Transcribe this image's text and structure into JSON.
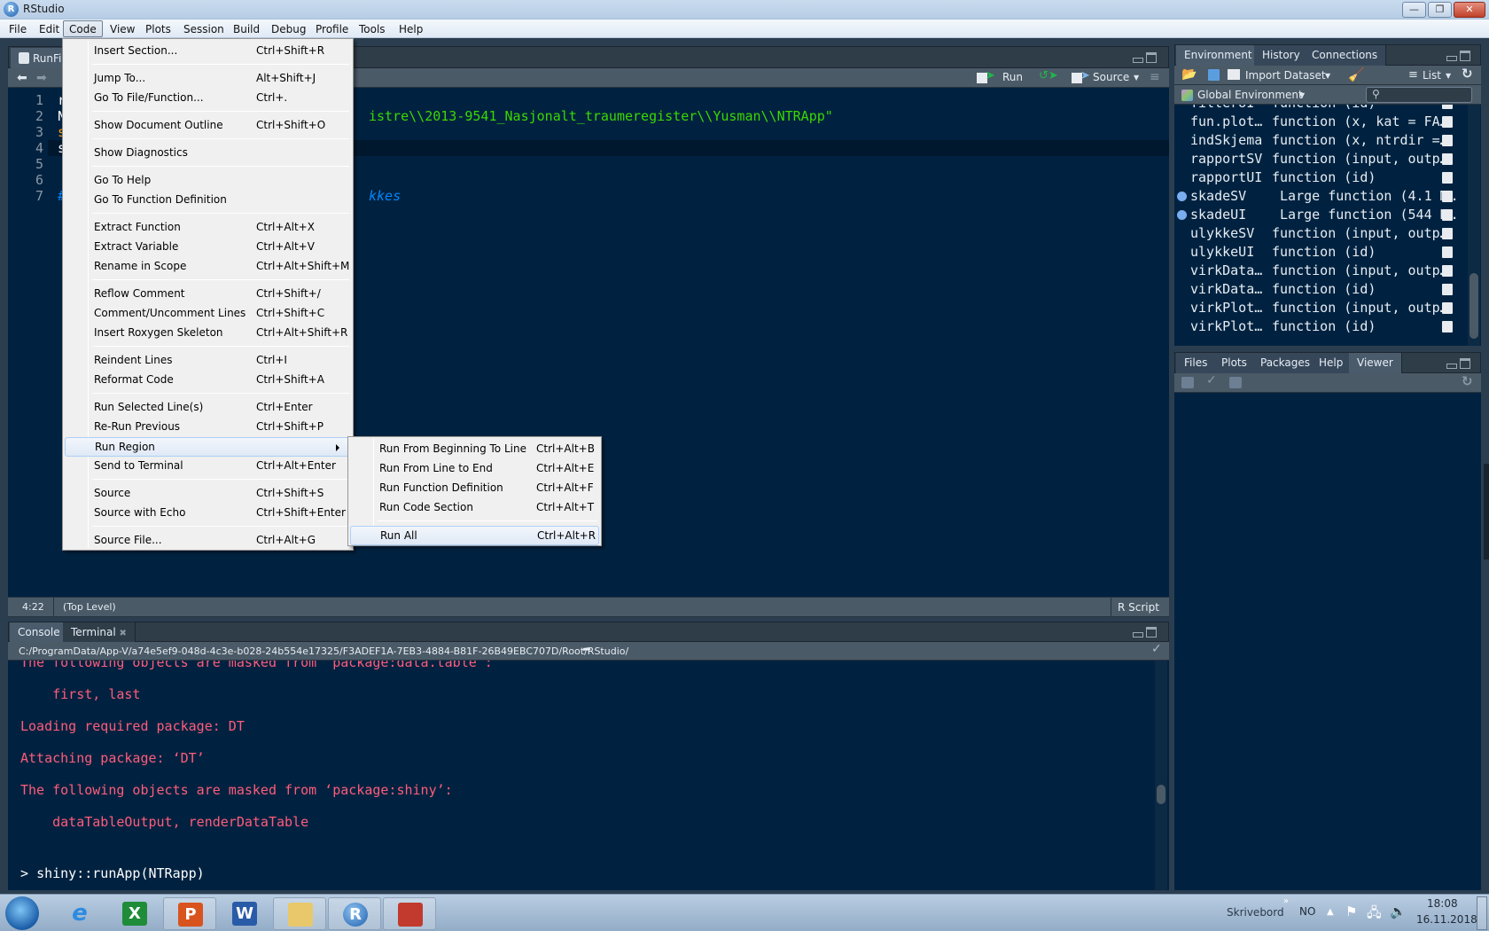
{
  "window": {
    "title": "RStudio",
    "app_icon": "R",
    "controls": [
      "minimize",
      "restore",
      "close"
    ]
  },
  "menubar": [
    "File",
    "Edit",
    "Code",
    "View",
    "Plots",
    "Session",
    "Build",
    "Debug",
    "Profile",
    "Tools",
    "Help"
  ],
  "menubar_open": "Code",
  "editor": {
    "tab_label": "RunFil",
    "toolbar": {
      "run": "Run",
      "source": "Source"
    },
    "lines": [
      {
        "no": "1",
        "visible": "rm"
      },
      {
        "no": "2",
        "visible": "NT",
        "string_tail": "istre\\\\2013-9541_Nasjonalt_traumeregister\\\\Yusman\\\\NTRApp\""
      },
      {
        "no": "3",
        "visible": "sc"
      },
      {
        "no": "4",
        "visible": "sh"
      },
      {
        "no": "5",
        "visible": ""
      },
      {
        "no": "6",
        "visible": ""
      },
      {
        "no": "7",
        "visible": "##",
        "comment_tail": "kkes"
      }
    ],
    "status": {
      "position": "4:22",
      "scope": "(Top Level)",
      "file_type": "R Script"
    }
  },
  "code_menu": {
    "groups": [
      [
        {
          "label": "Insert Section...",
          "key": "Ctrl+Shift+R"
        }
      ],
      [
        {
          "label": "Jump To...",
          "key": "Alt+Shift+J"
        },
        {
          "label": "Go To File/Function...",
          "key": "Ctrl+."
        }
      ],
      [
        {
          "label": "Show Document Outline",
          "key": "Ctrl+Shift+O"
        }
      ],
      [
        {
          "label": "Show Diagnostics",
          "key": ""
        }
      ],
      [
        {
          "label": "Go To Help",
          "key": ""
        },
        {
          "label": "Go To Function Definition",
          "key": ""
        }
      ],
      [
        {
          "label": "Extract Function",
          "key": "Ctrl+Alt+X"
        },
        {
          "label": "Extract Variable",
          "key": "Ctrl+Alt+V"
        },
        {
          "label": "Rename in Scope",
          "key": "Ctrl+Alt+Shift+M"
        }
      ],
      [
        {
          "label": "Reflow Comment",
          "key": "Ctrl+Shift+/"
        },
        {
          "label": "Comment/Uncomment Lines",
          "key": "Ctrl+Shift+C"
        },
        {
          "label": "Insert Roxygen Skeleton",
          "key": "Ctrl+Alt+Shift+R"
        }
      ],
      [
        {
          "label": "Reindent Lines",
          "key": "Ctrl+I"
        },
        {
          "label": "Reformat Code",
          "key": "Ctrl+Shift+A"
        }
      ],
      [
        {
          "label": "Run Selected Line(s)",
          "key": "Ctrl+Enter"
        },
        {
          "label": "Re-Run Previous",
          "key": "Ctrl+Shift+P"
        },
        {
          "label": "Run Region",
          "key": "",
          "submenu": true,
          "highlighted": true
        },
        {
          "label": "Send to Terminal",
          "key": "Ctrl+Alt+Enter"
        }
      ],
      [
        {
          "label": "Source",
          "key": "Ctrl+Shift+S"
        },
        {
          "label": "Source with Echo",
          "key": "Ctrl+Shift+Enter"
        }
      ],
      [
        {
          "label": "Source File...",
          "key": "Ctrl+Alt+G"
        }
      ]
    ]
  },
  "run_region_submenu": {
    "groups": [
      [
        {
          "label": "Run From Beginning To Line",
          "key": "Ctrl+Alt+B"
        },
        {
          "label": "Run From Line to End",
          "key": "Ctrl+Alt+E"
        },
        {
          "label": "Run Function Definition",
          "key": "Ctrl+Alt+F"
        },
        {
          "label": "Run Code Section",
          "key": "Ctrl+Alt+T"
        }
      ],
      [
        {
          "label": "Run All",
          "key": "Ctrl+Alt+R",
          "highlighted": true
        }
      ]
    ]
  },
  "environment_pane": {
    "tabs": [
      "Environment",
      "History",
      "Connections"
    ],
    "active_tab": "Environment",
    "toolbar": {
      "import": "Import Dataset",
      "view": "List"
    },
    "scope": "Global Environment",
    "search_placeholder": "",
    "rows": [
      {
        "name": "filterUI",
        "value": "function (id)",
        "expandable": false
      },
      {
        "name": "fun.plot…",
        "value": "function (x, kat = FA…",
        "expandable": false
      },
      {
        "name": "indSkjema",
        "value": "function (x, ntrdir =…",
        "expandable": false
      },
      {
        "name": "rapportSV",
        "value": "function (input, outp…",
        "expandable": false
      },
      {
        "name": "rapportUI",
        "value": "function (id)",
        "expandable": false
      },
      {
        "name": "skadeSV",
        "value": " Large function (4.1 M…",
        "expandable": true
      },
      {
        "name": "skadeUI",
        "value": " Large function (544 K…",
        "expandable": true
      },
      {
        "name": "ulykkeSV",
        "value": "function (input, outp…",
        "expandable": false
      },
      {
        "name": "ulykkeUI",
        "value": "function (id)",
        "expandable": false
      },
      {
        "name": "virkData…",
        "value": "function (input, outp…",
        "expandable": false
      },
      {
        "name": "virkData…",
        "value": "function (id)",
        "expandable": false
      },
      {
        "name": "virkPlot…",
        "value": "function (input, outp…",
        "expandable": false
      },
      {
        "name": "virkPlot…",
        "value": "function (id)",
        "expandable": false
      }
    ]
  },
  "files_pane": {
    "tabs": [
      "Files",
      "Plots",
      "Packages",
      "Help",
      "Viewer"
    ],
    "active_tab": "Viewer"
  },
  "console_pane": {
    "tabs": [
      "Console",
      "Terminal"
    ],
    "active_tab": "Console",
    "path": "C:/ProgramData/App-V/a74e5ef9-048d-4c3e-b028-24b554e17325/F3ADEF1A-7EB3-4884-B81F-26B49EBC707D/Root/RStudio/",
    "lines": [
      "The following objects are masked from ‘package:data.table’:",
      "",
      "    first, last",
      "",
      "Loading required package: DT",
      "",
      "Attaching package: ‘DT’",
      "",
      "The following objects are masked from ‘package:shiny’:",
      "",
      "    dataTableOutput, renderDataTable",
      "",
      ""
    ],
    "prompt": "> ",
    "command": "shiny::runApp(NTRapp)"
  },
  "taskbar": {
    "apps": [
      "Start",
      "Internet Explorer",
      "Excel",
      "PowerPoint",
      "Word",
      "Explorer",
      "RStudio",
      "Acrobat"
    ],
    "desktop_label": "Skrivebord",
    "language": "NO",
    "time": "18:08",
    "date": "16.11.2018"
  },
  "colors": {
    "editor_bg": "#002240",
    "string": "#3ad900",
    "keyword": "#ff9d00",
    "comment": "#0088ff",
    "console_error": "#ff5c7a",
    "menu_bg": "#f0f0f0"
  }
}
